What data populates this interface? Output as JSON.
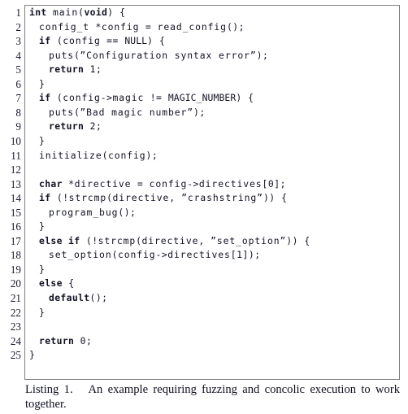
{
  "figure": {
    "kind": "code-listing-figure",
    "frame_color": "#808080",
    "background": "#ffffff",
    "text_color": "#121225"
  },
  "code": {
    "language": "C",
    "first_line_number": 1,
    "last_line_number": 25,
    "lines": [
      {
        "n": "1",
        "indent": 0,
        "text": "int main(void) {"
      },
      {
        "n": "2",
        "indent": 2,
        "text": "config_t *config = read_config();"
      },
      {
        "n": "3",
        "indent": 2,
        "text": "if (config == NULL) {"
      },
      {
        "n": "4",
        "indent": 4,
        "text": "puts(\"Configuration syntax error\");"
      },
      {
        "n": "5",
        "indent": 4,
        "text": "return 1;"
      },
      {
        "n": "6",
        "indent": 2,
        "text": "}"
      },
      {
        "n": "7",
        "indent": 2,
        "text": "if (config->magic != MAGIC_NUMBER) {"
      },
      {
        "n": "8",
        "indent": 4,
        "text": "puts(\"Bad magic number\");"
      },
      {
        "n": "9",
        "indent": 4,
        "text": "return 2;"
      },
      {
        "n": "10",
        "indent": 2,
        "text": "}"
      },
      {
        "n": "11",
        "indent": 2,
        "text": "initialize(config);"
      },
      {
        "n": "12",
        "indent": 0,
        "text": ""
      },
      {
        "n": "13",
        "indent": 2,
        "text": "char *directive = config->directives[0];"
      },
      {
        "n": "14",
        "indent": 2,
        "text": "if (!strcmp(directive, \"crashstring\")) {"
      },
      {
        "n": "15",
        "indent": 4,
        "text": "program_bug();"
      },
      {
        "n": "16",
        "indent": 2,
        "text": "}"
      },
      {
        "n": "17",
        "indent": 2,
        "text": "else if (!strcmp(directive, \"set_option\")) {"
      },
      {
        "n": "18",
        "indent": 4,
        "text": "set_option(config->directives[1]);"
      },
      {
        "n": "19",
        "indent": 2,
        "text": "}"
      },
      {
        "n": "20",
        "indent": 2,
        "text": "else {"
      },
      {
        "n": "21",
        "indent": 4,
        "text": "default();"
      },
      {
        "n": "22",
        "indent": 2,
        "text": "}"
      },
      {
        "n": "23",
        "indent": 0,
        "text": ""
      },
      {
        "n": "24",
        "indent": 2,
        "text": "return 0;"
      },
      {
        "n": "25",
        "indent": 0,
        "text": "}"
      }
    ]
  },
  "caption": {
    "label": "Listing 1.",
    "text": "An example requiring fuzzing and concolic execution to work together.",
    "full": "Listing 1.   An example requiring fuzzing and concolic execution to work together."
  }
}
